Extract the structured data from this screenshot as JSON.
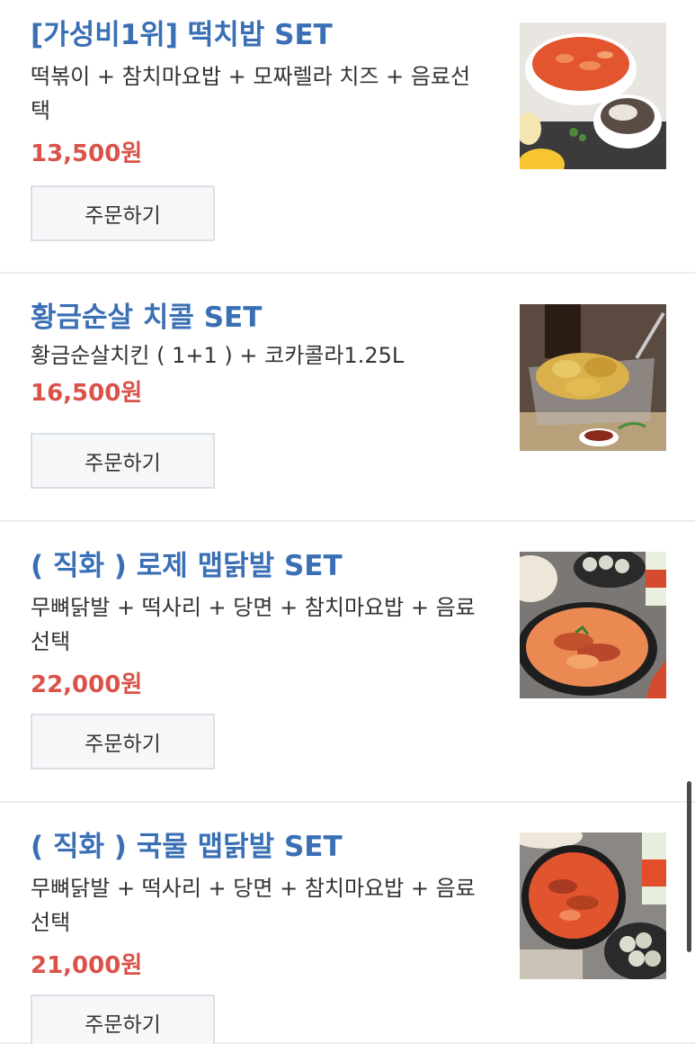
{
  "menu": {
    "items": [
      {
        "title": "[가성비1위] 떡치밥 SET",
        "description": "떡볶이 + 참치마요밥 + 모짜렐라 치즈 + 음료선택",
        "price": "13,500원",
        "order_label": "주문하기",
        "image": "tteokbokki-set-photo"
      },
      {
        "title": "황금순살 치콜 SET",
        "description": "황금순살치킨 ( 1+1 ) + 코카콜라1.25L",
        "price": "16,500원",
        "order_label": "주문하기",
        "image": "fried-chicken-basket-photo"
      },
      {
        "title": "( 직화 ) 로제 맵닭발 SET",
        "description": "무뼈닭발 + 떡사리 + 당면 + 참치마요밥 + 음료선택",
        "price": "22,000원",
        "order_label": "주문하기",
        "image": "rose-chicken-feet-photo"
      },
      {
        "title": "( 직화 ) 국물 맵닭발 SET",
        "description": "무뼈닭발 + 떡사리 + 당면 + 참치마요밥 + 음료선택",
        "price": "21,000원",
        "order_label": "주문하기",
        "image": "soup-chicken-feet-photo"
      }
    ]
  },
  "colors": {
    "title": "#3a6fb5",
    "price": "#d9534a",
    "button_bg": "#f6f7f9",
    "divider": "#ececec"
  }
}
